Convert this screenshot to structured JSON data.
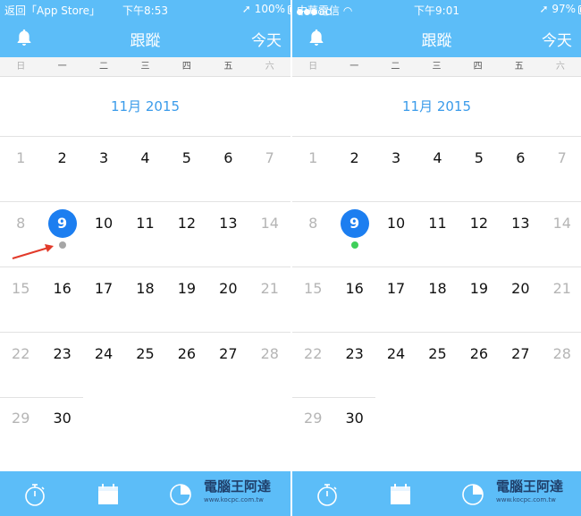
{
  "screens": [
    {
      "status": {
        "left": "返回「App Store」",
        "time": "下午8:53",
        "right": "100%"
      },
      "nav": {
        "title": "跟蹤",
        "today": "今天"
      },
      "weekdays": [
        "日",
        "一",
        "二",
        "三",
        "四",
        "五",
        "六"
      ],
      "month": "11月 2015",
      "weeks": [
        [
          "1",
          "2",
          "3",
          "4",
          "5",
          "6",
          "7"
        ],
        [
          "8",
          "9",
          "10",
          "11",
          "12",
          "13",
          "14"
        ],
        [
          "15",
          "16",
          "17",
          "18",
          "19",
          "20",
          "21"
        ],
        [
          "22",
          "23",
          "24",
          "25",
          "26",
          "27",
          "28"
        ],
        [
          "29",
          "30"
        ]
      ],
      "today": "9",
      "dot_color": "#a6a6a6",
      "watermark": {
        "title": "電腦王阿達",
        "url": "www.kocpc.com.tw"
      }
    },
    {
      "status": {
        "carrier": "中華電信",
        "time": "下午9:01",
        "right": "97%"
      },
      "nav": {
        "title": "跟蹤",
        "today": "今天"
      },
      "weekdays": [
        "日",
        "一",
        "二",
        "三",
        "四",
        "五",
        "六"
      ],
      "month": "11月 2015",
      "weeks": [
        [
          "1",
          "2",
          "3",
          "4",
          "5",
          "6",
          "7"
        ],
        [
          "8",
          "9",
          "10",
          "11",
          "12",
          "13",
          "14"
        ],
        [
          "15",
          "16",
          "17",
          "18",
          "19",
          "20",
          "21"
        ],
        [
          "22",
          "23",
          "24",
          "25",
          "26",
          "27",
          "28"
        ],
        [
          "29",
          "30"
        ]
      ],
      "today": "9",
      "dot_color": "#3fcf5a",
      "watermark": {
        "title": "電腦王阿達",
        "url": "www.kocpc.com.tw"
      }
    }
  ],
  "colors": {
    "accent": "#5cbdf8",
    "today_circle": "#1c7ef0",
    "month_text": "#3a9bea",
    "arrow": "#e23a2a"
  },
  "icons": {
    "nav_left": "bell-icon",
    "tab1": "stopwatch-icon",
    "tab2": "calendar-icon",
    "tab3": "pie-chart-icon"
  }
}
